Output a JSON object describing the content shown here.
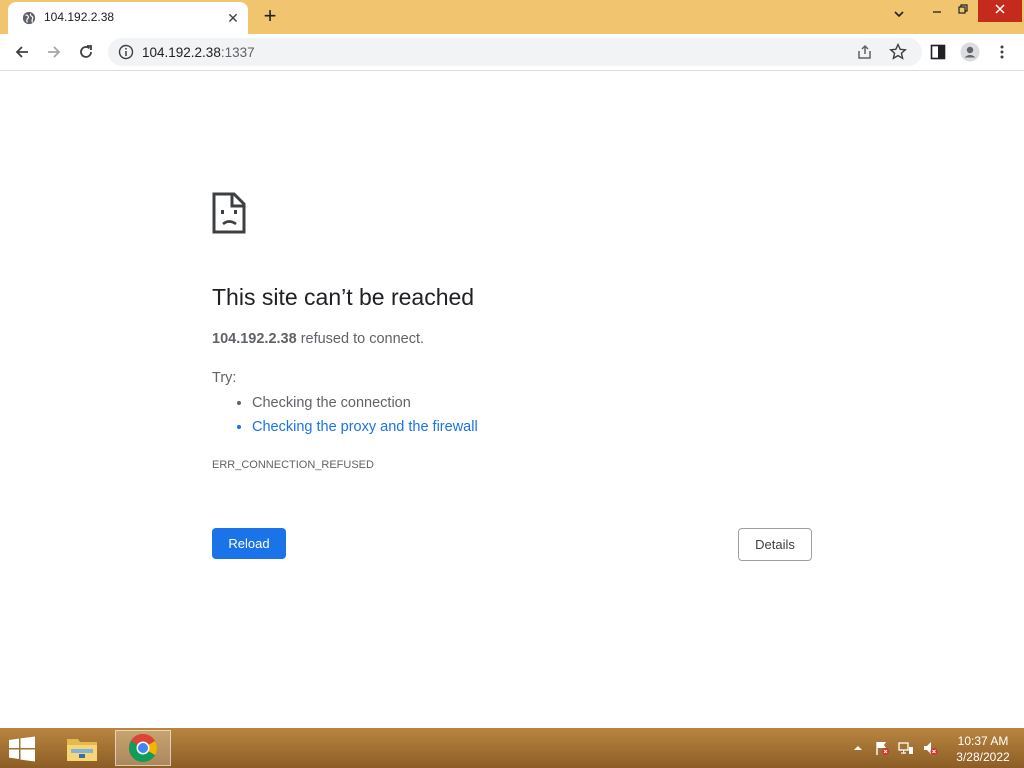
{
  "browser": {
    "tab": {
      "title": "104.192.2.38",
      "favicon": "globe-icon"
    },
    "url": {
      "host": "104.192.2.38",
      "port": ":1337"
    },
    "controls": {
      "tab_search_icon": "chevron-down-icon",
      "minimize_icon": "minimize-icon",
      "restore_icon": "restore-icon",
      "close_icon": "close-icon"
    }
  },
  "error_page": {
    "icon": "sad-document-icon",
    "title": "This site can’t be reached",
    "host": "104.192.2.38",
    "message_suffix": " refused to connect.",
    "try_label": "Try:",
    "suggestions": [
      {
        "text": "Checking the connection",
        "is_link": false
      },
      {
        "text": "Checking the proxy and the firewall",
        "is_link": true
      }
    ],
    "error_code": "ERR_CONNECTION_REFUSED",
    "reload_label": "Reload",
    "details_label": "Details"
  },
  "taskbar": {
    "apps": [
      "file-explorer-icon",
      "chrome-icon"
    ],
    "tray_icons": [
      "show-hidden-icons-icon",
      "action-center-flag-icon",
      "network-icon",
      "volume-muted-icon"
    ],
    "time": "10:37 AM",
    "date": "3/28/2022"
  },
  "colors": {
    "titlebar": "#f1c46f",
    "accent_blue": "#1a73e8",
    "taskbar": "#a8763a",
    "close_red": "#c42b1c"
  }
}
